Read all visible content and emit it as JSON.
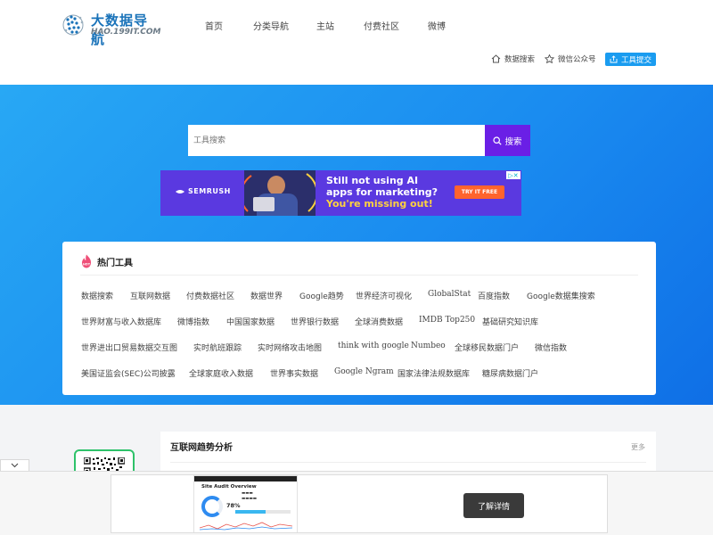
{
  "header": {
    "logo_cn": "大数据导航",
    "logo_en": "HAO.199IT.COM",
    "nav": [
      "首页",
      "分类导航",
      "主站",
      "付费社区",
      "微博"
    ],
    "tools": {
      "data_search": "数据搜索",
      "wechat": "微信公众号",
      "submit": "工具提交"
    }
  },
  "hero": {
    "search_placeholder": "工具搜索",
    "search_button": "搜索"
  },
  "ad": {
    "brand": "SEMRUSH",
    "headline": [
      "Still not using AI",
      "apps for marketing?",
      "You're missing out!"
    ],
    "cta": "TRY IT FREE"
  },
  "hot": {
    "title": "热门工具",
    "rows": [
      [
        "数据搜索",
        "互联网数据",
        "付费数据社区",
        "数据世界",
        "Google趋势",
        "世界经济可视化",
        "GlobalStat",
        "百度指数",
        "Google数据集搜索"
      ],
      [
        "世界财富与收入数据库",
        "微博指数",
        "中国国家数据",
        "世界银行数据",
        "全球消费数据",
        "IMDB Top250",
        "基础研究知识库"
      ],
      [
        "世界进出口贸易数据交互图",
        "实时航班跟踪",
        "实时网络攻击地图",
        "think with google",
        "Numbeo",
        "全球移民数据门户",
        "微信指数"
      ],
      [
        "美国证监会(SEC)公司披露",
        "全球家庭收入数据",
        "世界事实数据",
        "Google Ngram",
        "国家法律法规数据库",
        "糖尿病数据门户"
      ]
    ]
  },
  "section": {
    "title": "互联网趋势分析",
    "more": "更多"
  },
  "bottom_ad": {
    "audit_title": "Site Audit Overview",
    "audit_pct": "78%",
    "detail_button": "了解详情"
  },
  "colors": {
    "hero_blue": "#1a8cf0",
    "search_purple": "#6a1fe6",
    "submit_blue": "#1a9cf0",
    "ad_purple": "#5a39e0",
    "qr_green": "#2ec26a"
  }
}
